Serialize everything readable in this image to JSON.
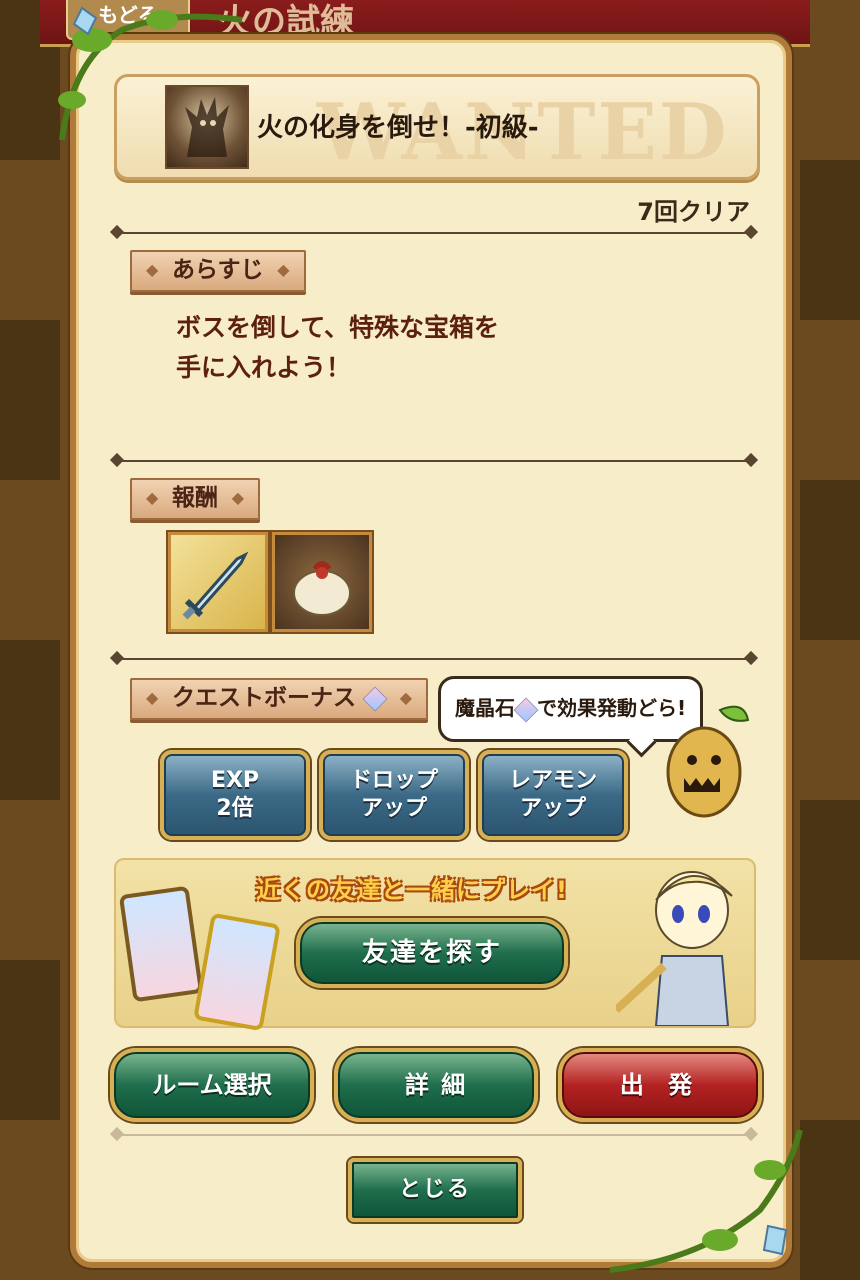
{
  "top_bar": {
    "back_label": "もどる",
    "screen_title": "火の試練"
  },
  "quest": {
    "title": "火の化身を倒せ！-初級-",
    "watermark": "WANTED",
    "clear_count": "7回クリア"
  },
  "sections": {
    "synopsis_label": "あらすじ",
    "synopsis_text_line1": "ボスを倒して、特殊な宝箱を",
    "synopsis_text_line2": "手に入れよう！",
    "reward_label": "報酬",
    "bonus_label": "クエストボーナス"
  },
  "rewards": [
    {
      "icon": "sword-icon"
    },
    {
      "icon": "treasure-bag-icon"
    }
  ],
  "bonus_hint": {
    "text_prefix": "魔晶石",
    "text_suffix": "で効果発動どら!"
  },
  "bonus_buttons": [
    {
      "label": "EXP\n2倍"
    },
    {
      "label": "ドロップ\nアップ"
    },
    {
      "label": "レアモン\nアップ"
    }
  ],
  "friend": {
    "title": "近くの友達と一緒にプレイ!",
    "find_button": "友達を探す"
  },
  "actions": {
    "room_select": "ルーム選択",
    "details": "詳 細",
    "depart": "出 発",
    "close": "とじる"
  },
  "colors": {
    "panel_bg": "#f8edc9",
    "green_button": "#1f6e4c",
    "red_button": "#b42222",
    "blue_button": "#3c6a86",
    "gold_border": "#d6b052"
  }
}
